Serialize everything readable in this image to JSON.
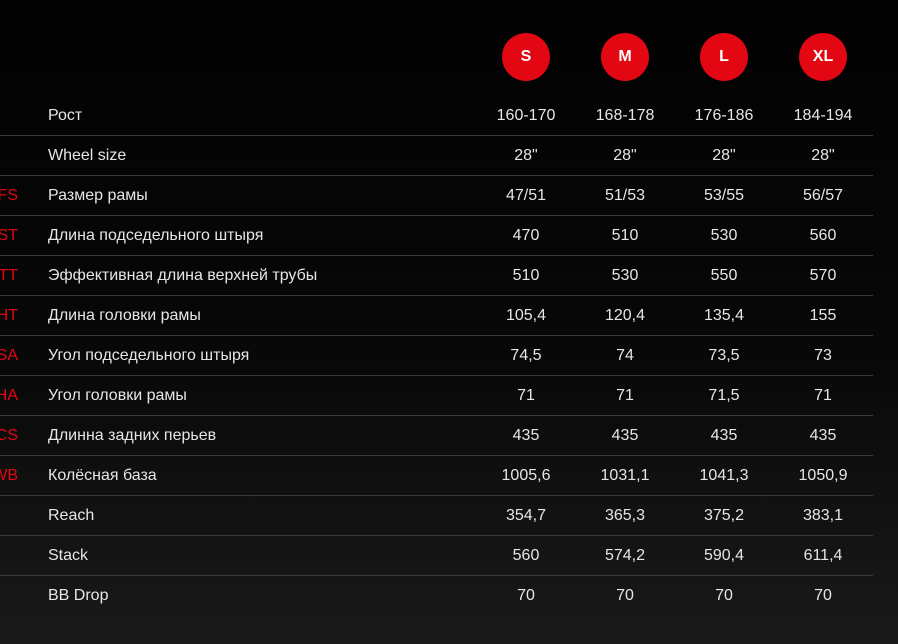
{
  "sizes": [
    "S",
    "M",
    "L",
    "XL"
  ],
  "rows": [
    {
      "code": "",
      "label": "Рост",
      "values": [
        "160-170",
        "168-178",
        "176-186",
        "184-194"
      ]
    },
    {
      "code": "",
      "label": "Wheel size",
      "values": [
        "28\"",
        "28\"",
        "28\"",
        "28\""
      ]
    },
    {
      "code": "FS",
      "label": "Размер рамы",
      "values": [
        "47/51",
        "51/53",
        "53/55",
        "56/57"
      ]
    },
    {
      "code": "ST",
      "label": "Длина подседельного штыря",
      "values": [
        "470",
        "510",
        "530",
        "560"
      ]
    },
    {
      "code": "TT",
      "label": "Эффективная длина верхней трубы",
      "values": [
        "510",
        "530",
        "550",
        "570"
      ]
    },
    {
      "code": "HT",
      "label": "Длина головки рамы",
      "values": [
        "105,4",
        "120,4",
        "135,4",
        "155"
      ]
    },
    {
      "code": "SA",
      "label": "Угол подседельного штыря",
      "values": [
        "74,5",
        "74",
        "73,5",
        "73"
      ]
    },
    {
      "code": "HA",
      "label": "Угол головки рамы",
      "values": [
        "71",
        "71",
        "71,5",
        "71"
      ]
    },
    {
      "code": "CS",
      "label": "Длинна задних перьев",
      "values": [
        "435",
        "435",
        "435",
        "435"
      ]
    },
    {
      "code": "WB",
      "label": "Колёсная база",
      "values": [
        "1005,6",
        "1031,1",
        "1041,3",
        "1050,9"
      ]
    },
    {
      "code": "",
      "label": "Reach",
      "values": [
        "354,7",
        "365,3",
        "375,2",
        "383,1"
      ]
    },
    {
      "code": "",
      "label": "Stack",
      "values": [
        "560",
        "574,2",
        "590,4",
        "611,4"
      ]
    },
    {
      "code": "",
      "label": "BB Drop",
      "values": [
        "70",
        "70",
        "70",
        "70"
      ]
    }
  ],
  "colors": {
    "accent": "#e30613",
    "text": "#e6e6e6",
    "divider": "#3a3a3a",
    "background": "#050505"
  }
}
